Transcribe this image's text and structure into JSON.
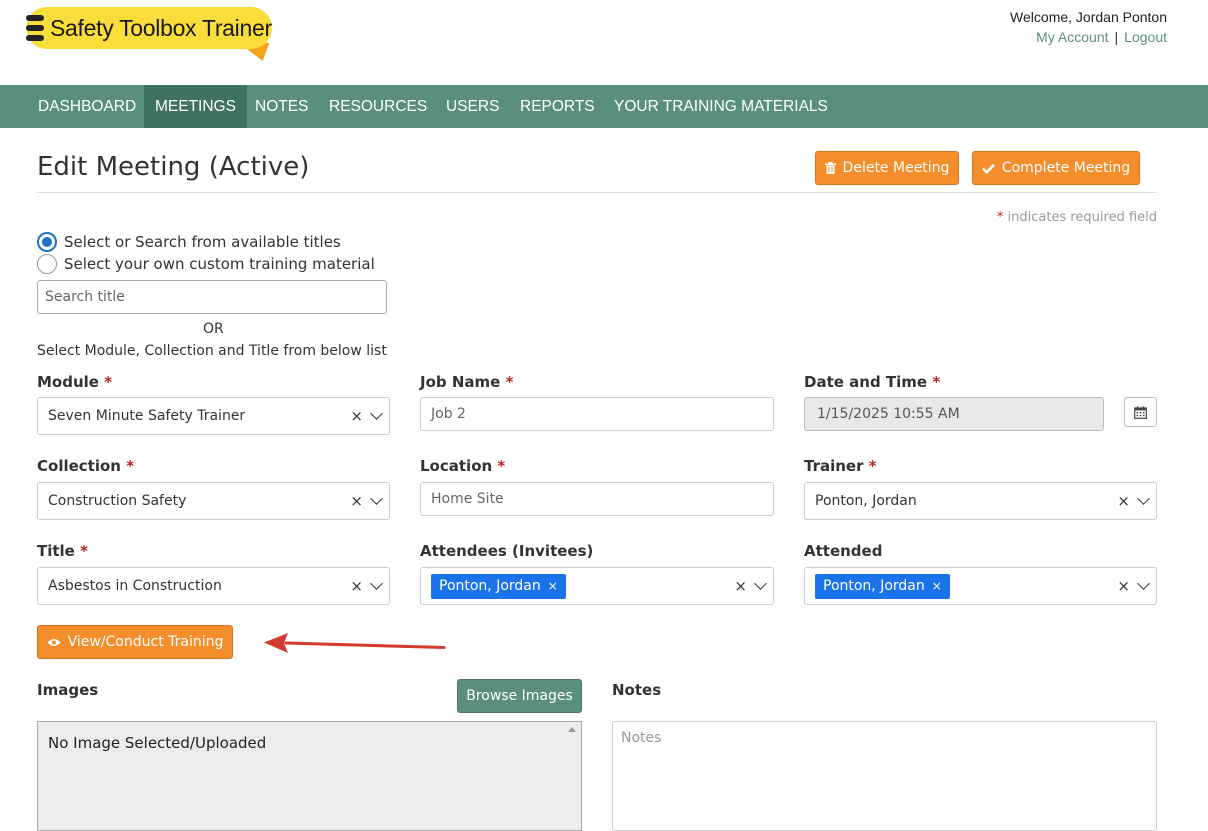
{
  "header": {
    "logo_text": "Safety Toolbox Trainer",
    "welcome": "Welcome, Jordan Ponton",
    "my_account": "My Account",
    "separator": "|",
    "logout": "Logout"
  },
  "nav": {
    "items": [
      "DASHBOARD",
      "MEETINGS",
      "NOTES",
      "RESOURCES",
      "USERS",
      "REPORTS",
      "YOUR TRAINING MATERIALS"
    ],
    "active": "MEETINGS"
  },
  "page": {
    "title": "Edit Meeting (Active)",
    "delete_button": "Delete Meeting",
    "complete_button": "Complete Meeting",
    "required_note_star": "*",
    "required_note": "indicates required field"
  },
  "source": {
    "option_available": "Select or Search from available titles",
    "option_custom": "Select your own custom training material",
    "selected": "available",
    "search_placeholder": "Search title",
    "or_text": "OR",
    "select_note": "Select Module, Collection and Title from below list"
  },
  "form": {
    "required_star": "*",
    "module": {
      "label": "Module",
      "value": "Seven Minute Safety Trainer"
    },
    "job_name": {
      "label": "Job Name",
      "value": "Job 2"
    },
    "date_time": {
      "label": "Date and Time",
      "value": "1/15/2025 10:55 AM"
    },
    "collection": {
      "label": "Collection",
      "value": "Construction Safety"
    },
    "location": {
      "label": "Location",
      "value": "Home Site"
    },
    "trainer": {
      "label": "Trainer",
      "value": "Ponton, Jordan"
    },
    "title": {
      "label": "Title",
      "value": "Asbestos in Construction"
    },
    "attendees": {
      "label": "Attendees (Invitees)",
      "tag": "Ponton, Jordan"
    },
    "attended": {
      "label": "Attended",
      "tag": "Ponton, Jordan"
    },
    "clear_glyph": "×",
    "tag_remove_glyph": "×"
  },
  "actions": {
    "view_conduct": "View/Conduct Training"
  },
  "images": {
    "label": "Images",
    "browse_button": "Browse Images",
    "empty_text": "No Image Selected/Uploaded"
  },
  "notes": {
    "label": "Notes",
    "placeholder": "Notes"
  },
  "colors": {
    "brand_green": "#5a8f7f",
    "nav_active": "#3f7263",
    "orange": "#f48e2c",
    "tag_blue": "#1a73e8",
    "annotation_arrow": "#d23b2e",
    "logo_yellow": "#f9dd3a"
  },
  "icons": {
    "delete": "trash-icon",
    "complete": "check-icon",
    "view": "eye-icon",
    "calendar": "calendar-icon"
  }
}
